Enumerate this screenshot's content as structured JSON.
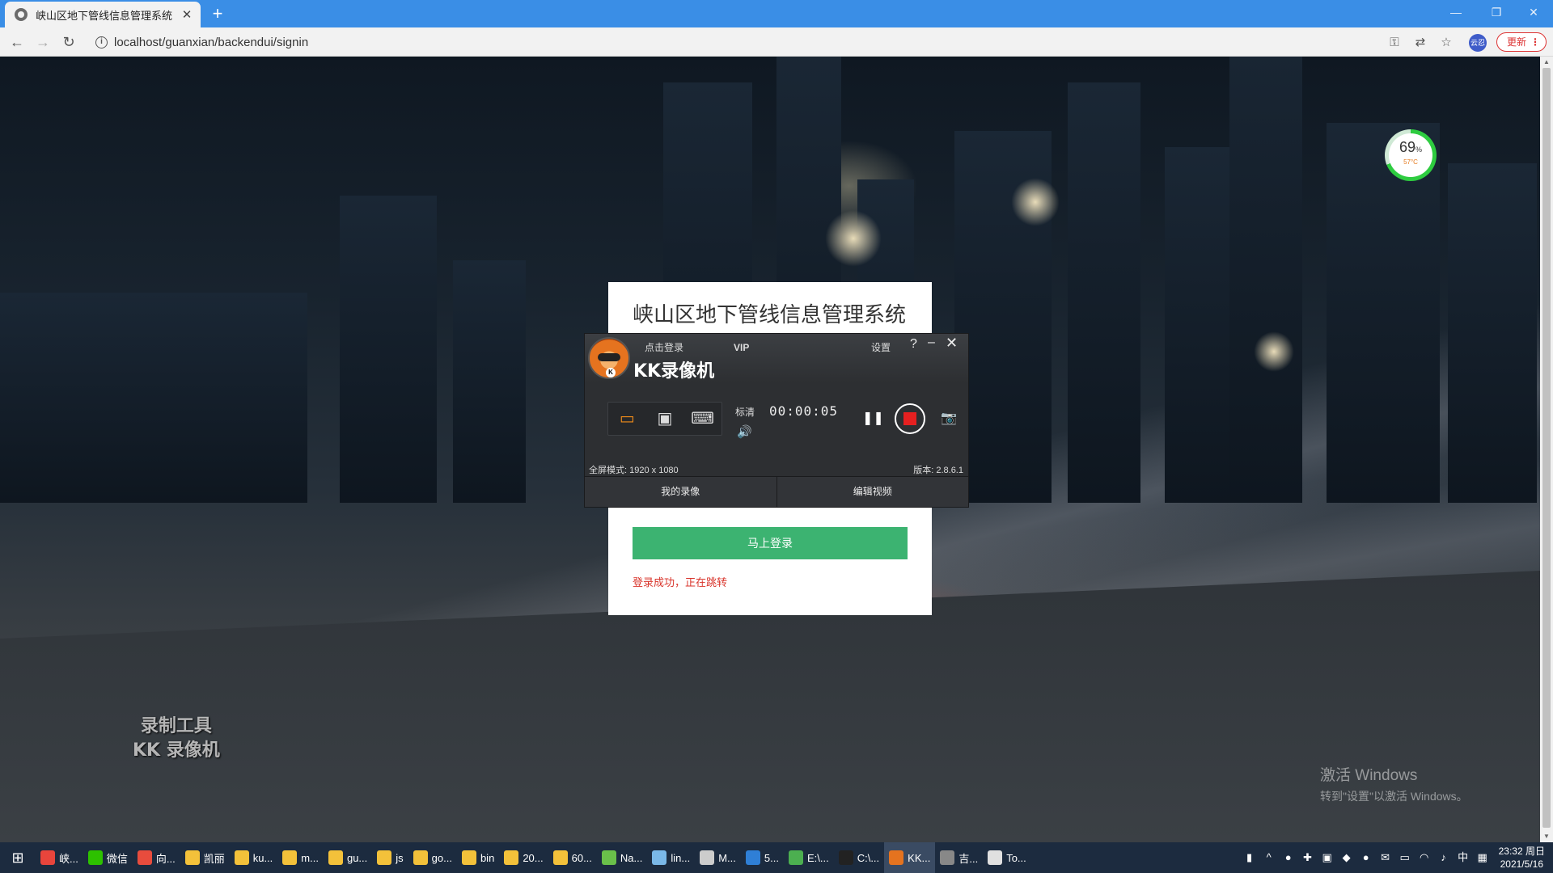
{
  "browser": {
    "tab_title": "峡山区地下管线信息管理系统",
    "tab_close": "✕",
    "new_tab": "+",
    "url": "localhost/guanxian/backendui/signin",
    "update_label": "更新",
    "profile_label": "云忍",
    "window_controls": [
      "—",
      "❐",
      "✕"
    ]
  },
  "login": {
    "title": "峡山区地下管线信息管理系统",
    "button_label": "马上登录",
    "status_message": "登录成功，正在跳转",
    "button_color": "#3cb371",
    "message_color": "#d9342b"
  },
  "kk_recorder": {
    "login_link": "点击登录",
    "vip": "VIP",
    "brand": "KK录像机",
    "settings": "设置",
    "help": "?",
    "minimize": "–",
    "close": "✕",
    "quality": "标清",
    "timer": "00:00:05",
    "status_left": "全屏模式: 1920 x 1080",
    "status_right": "版本: 2.8.6.1",
    "tabs": [
      "我的录像",
      "编辑视频"
    ],
    "logo_badge": "K",
    "accent_color": "#f08c1a",
    "record_color": "#e52020"
  },
  "overlays": {
    "kk_watermark_line1": "录制工具",
    "kk_watermark_line2": "KK 录像机",
    "activate_title": "激活 Windows",
    "activate_sub": "转到\"设置\"以激活 Windows。",
    "perf_percent": "69",
    "perf_percent_unit": "%",
    "perf_temp": "57°C"
  },
  "taskbar": {
    "items": [
      {
        "label": "峡...",
        "color": "#e8453c"
      },
      {
        "label": "微信",
        "color": "#2dc100"
      },
      {
        "label": "向...",
        "color": "#e84c3d"
      },
      {
        "label": "凯丽",
        "color": "#f3c13a"
      },
      {
        "label": "ku...",
        "color": "#f3c13a"
      },
      {
        "label": "m...",
        "color": "#f3c13a"
      },
      {
        "label": "gu...",
        "color": "#f3c13a"
      },
      {
        "label": "js",
        "color": "#f3c13a"
      },
      {
        "label": "go...",
        "color": "#f3c13a"
      },
      {
        "label": "bin",
        "color": "#f3c13a"
      },
      {
        "label": "20...",
        "color": "#f3c13a"
      },
      {
        "label": "60...",
        "color": "#f3c13a"
      },
      {
        "label": "Na...",
        "color": "#6ac04a"
      },
      {
        "label": "lin...",
        "color": "#7ab8e8"
      },
      {
        "label": "M...",
        "color": "#cccccc"
      },
      {
        "label": "5...",
        "color": "#2f7fd6"
      },
      {
        "label": "E:\\...",
        "color": "#4caf50"
      },
      {
        "label": "C:\\...",
        "color": "#222222"
      },
      {
        "label": "KK...",
        "color": "#e5731f"
      },
      {
        "label": "吉...",
        "color": "#888888"
      },
      {
        "label": "To...",
        "color": "#e0e0e0"
      }
    ],
    "ime": "中",
    "time": "23:32 周日",
    "date": "2021/5/16"
  }
}
